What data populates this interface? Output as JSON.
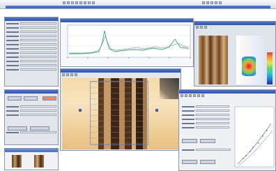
{
  "colors": {
    "titlebar": "#3a5fb8",
    "panel": "#e2e5ec",
    "plot_line": "#3fa85c",
    "plot_line2": "#7aa0d8",
    "colormap": [
      "#1e2fa0",
      "#1f7ed8",
      "#27c6d6",
      "#5fd36b",
      "#e6e34a",
      "#f2a13a",
      "#e23b2a"
    ]
  },
  "icons": [
    "toolbar-button-icon",
    "close-icon",
    "minimize-icon"
  ],
  "spectrum_window": {
    "ticks_x": [
      "",
      "",
      "",
      "",
      "",
      "",
      ""
    ]
  }
}
